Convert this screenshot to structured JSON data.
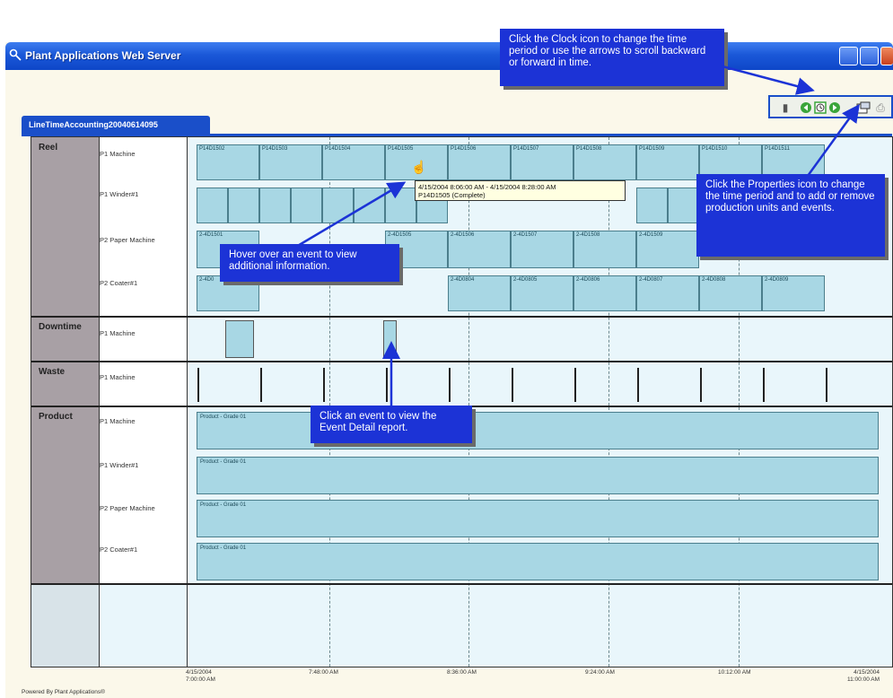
{
  "window": {
    "title": "Plant Applications Web Server"
  },
  "tab": {
    "label": "LineTimeAccounting20040614095"
  },
  "toolbar": {
    "icons": [
      "chart-icon",
      "back-arrow-icon",
      "clock-icon",
      "forward-arrow-icon",
      "properties-icon",
      "print-icon"
    ]
  },
  "groups": [
    {
      "label": "Reel",
      "units": [
        "P1 Machine",
        "P1 Winder#1",
        "P2 Paper Machine",
        "P2 Coater#1"
      ]
    },
    {
      "label": "Downtime",
      "units": [
        "P1 Machine"
      ]
    },
    {
      "label": "Waste",
      "units": [
        "P1 Machine"
      ]
    },
    {
      "label": "Product",
      "units": [
        "P1 Machine",
        "P1 Winder#1",
        "P2 Paper Machine",
        "P2 Coater#1"
      ]
    }
  ],
  "reel_events": {
    "p1_machine": [
      "P14D1502",
      "P14D1503",
      "P14D1504",
      "P14D1505",
      "P14D1506",
      "P14D1507",
      "P14D1508",
      "P14D1509",
      "P14D1510",
      "P14D1511"
    ],
    "p2_paper_machine": [
      "2-4D1501",
      "2-4D1502",
      "2-4D1503",
      "2-4D1505",
      "2-4D1506",
      "2-4D1507",
      "2-4D1508",
      "2-4D1509"
    ],
    "p2_coater": [
      "2-4D0",
      "2-4D0803",
      "2-4D0804",
      "2-4D0805",
      "2-4D0806",
      "2-4D0807",
      "2-4D0808",
      "2-4D0809"
    ]
  },
  "product_bar_label": "Product - Grade 01",
  "x_axis": {
    "labels": [
      {
        "line1": "4/15/2004",
        "line2": "7:00:00 AM"
      },
      {
        "line1": "7:48:00 AM",
        "line2": ""
      },
      {
        "line1": "8:36:00 AM",
        "line2": ""
      },
      {
        "line1": "9:24:00 AM",
        "line2": ""
      },
      {
        "line1": "10:12:00 AM",
        "line2": ""
      },
      {
        "line1": "4/15/2004",
        "line2": "11:00:00 AM"
      }
    ]
  },
  "tooltip": {
    "line1": "4/15/2004 8:06:00 AM  -  4/15/2004 8:28:00 AM",
    "line2": "P14D1505 (Complete)"
  },
  "callouts": {
    "clock": "Click the Clock icon to change the time period or use the arrows to scroll backward or forward in time.",
    "properties": "Click the Properties icon to change the time period and to add or remove production units and events.",
    "hover": "Hover over an event to view additional information.",
    "click": "Click an event to view the Event Detail report."
  },
  "footer": "Powered By Plant Applications®",
  "colors": {
    "title_bar": "#1a58d8",
    "callout": "#1c33d6",
    "event_fill": "#a8d7e4",
    "group_cell": "#a8a0a5"
  }
}
